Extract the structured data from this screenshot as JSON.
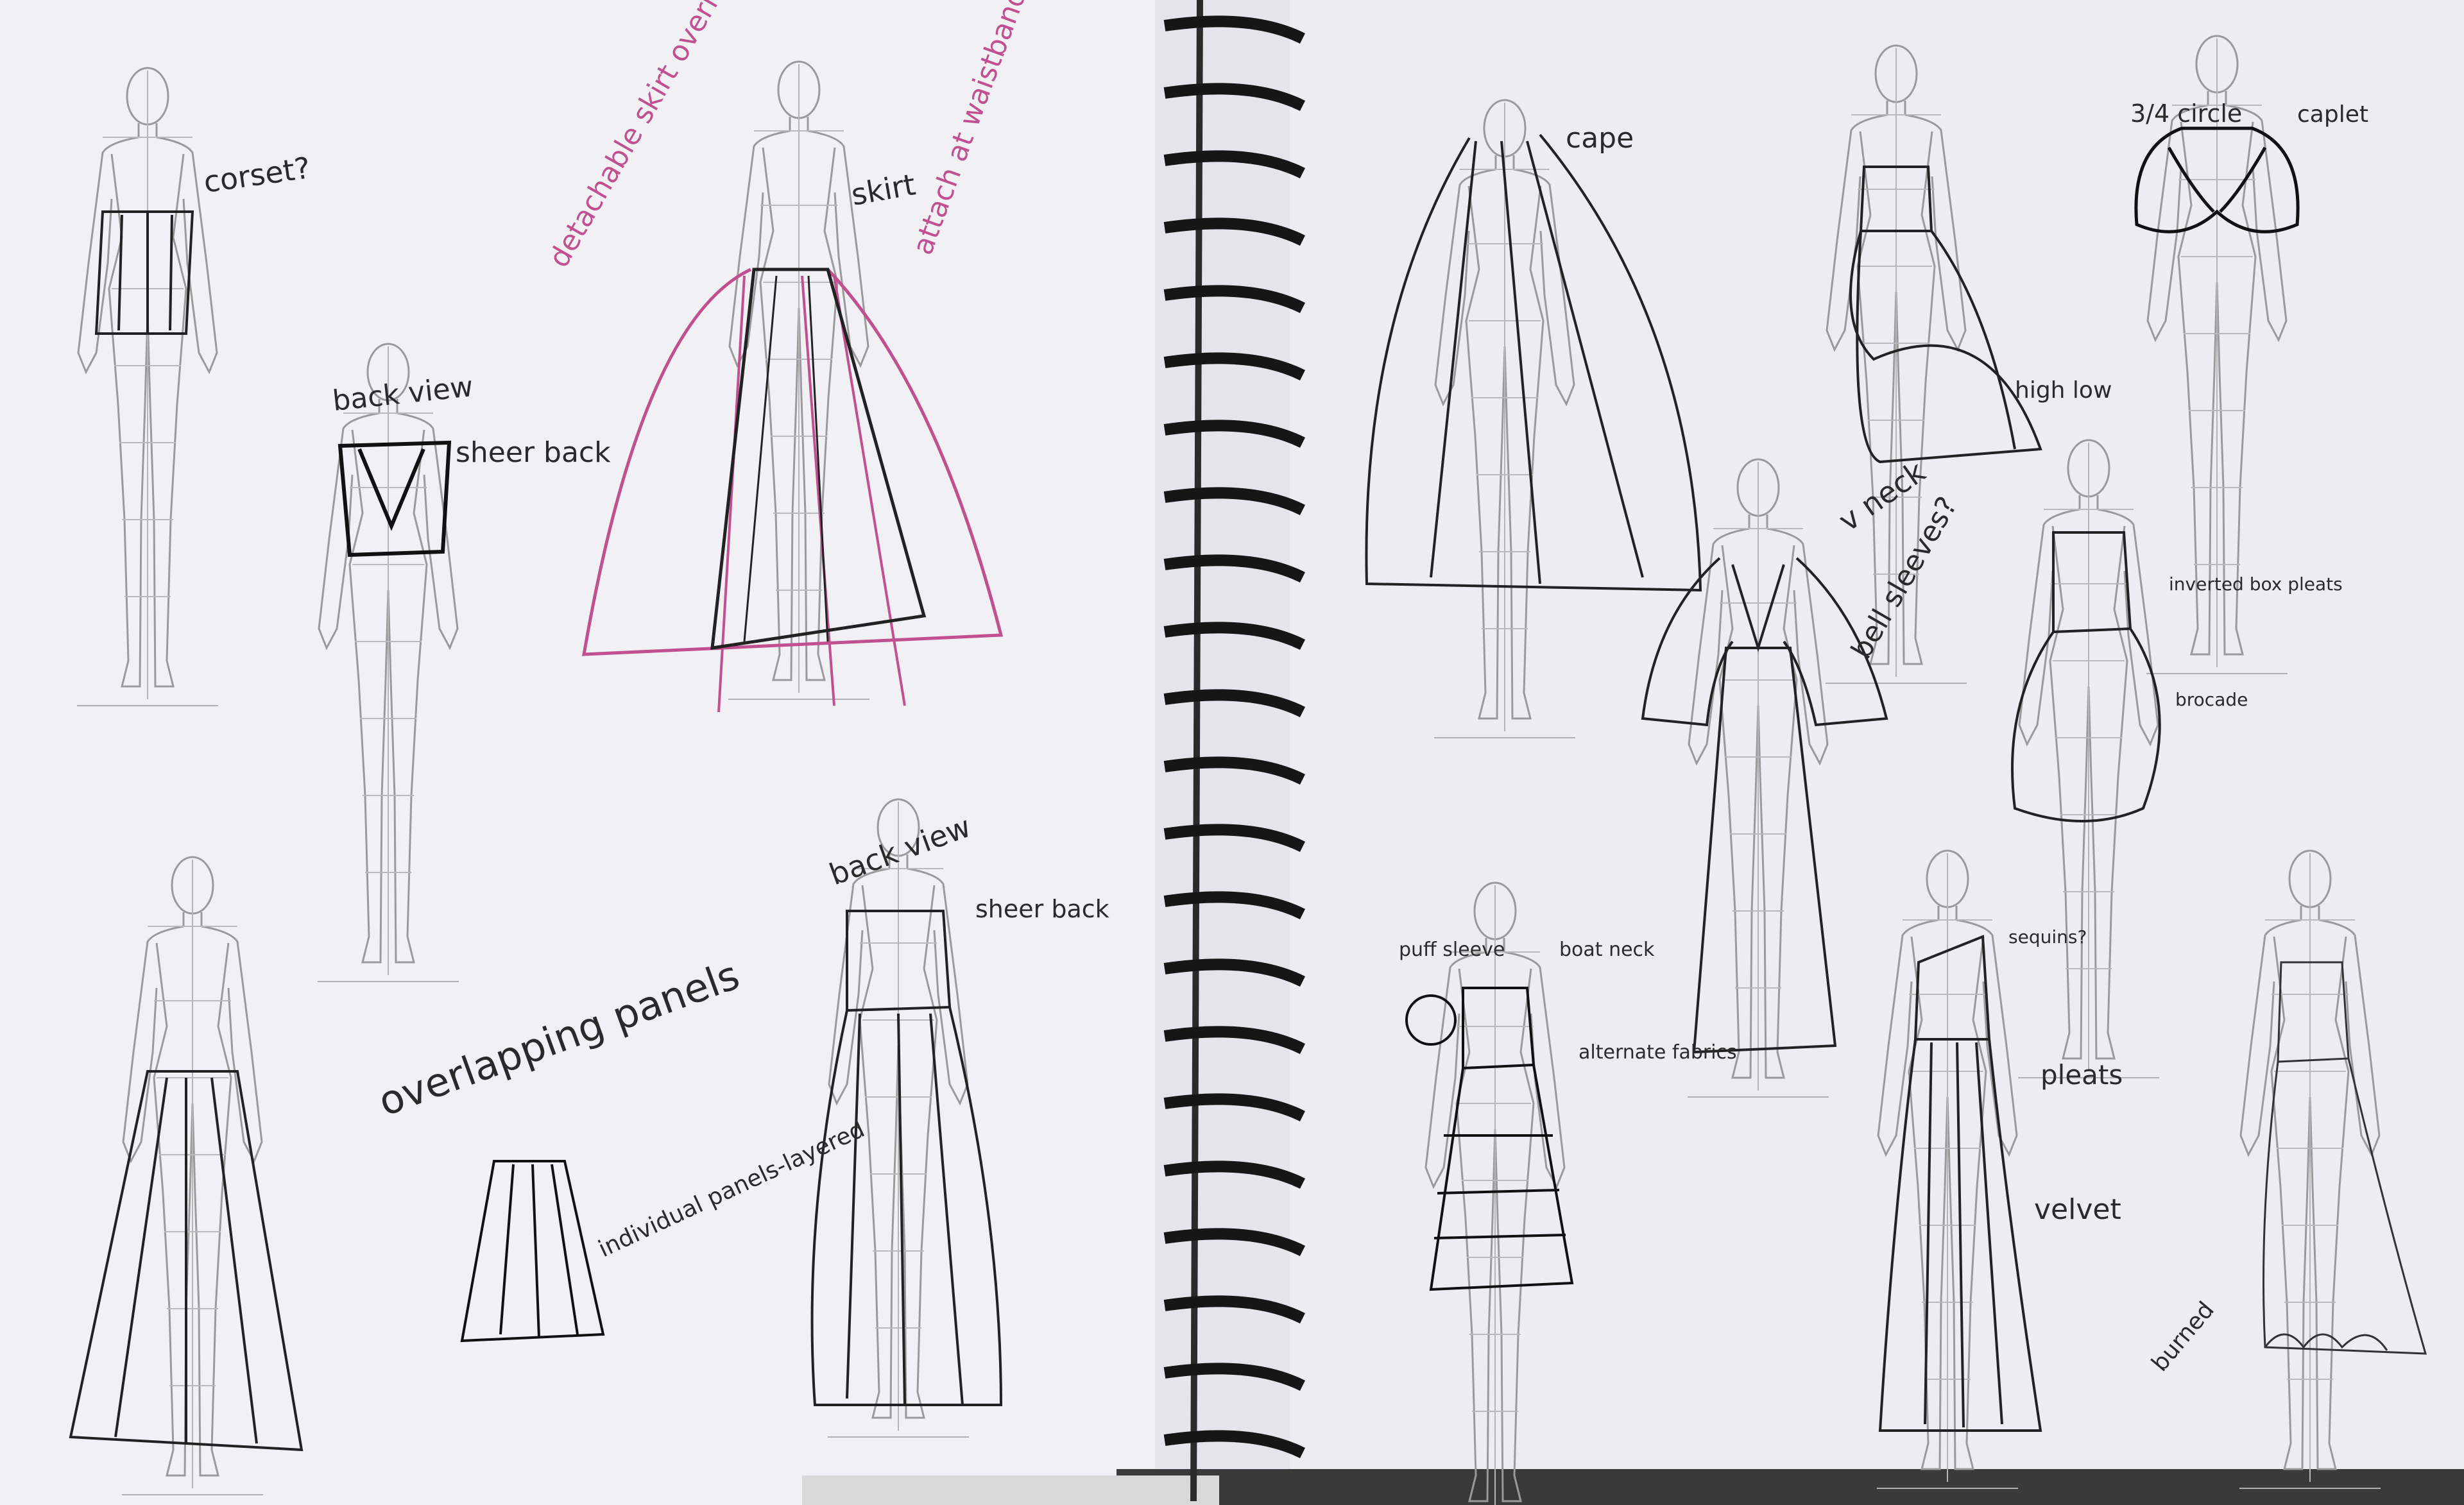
{
  "sketchbook": {
    "left_page": {
      "notes": {
        "corset": "corset?",
        "back_view_1": "back view",
        "sheer_back_1": "sheer back",
        "detachable": "detachable skirt overlay",
        "skirt": "skirt",
        "attach": "attach at waistband",
        "overlapping": "overlapping panels",
        "individual": "individual panels-layered",
        "back_view_2": "back view",
        "sheer_back_2": "sheer back"
      }
    },
    "right_page": {
      "notes": {
        "cape": "cape",
        "circle": "3/4 circle",
        "caplet": "caplet",
        "high_low": "high low",
        "v_neck": "v neck",
        "bell_sleeves": "bell sleeves?",
        "inverted": "inverted box pleats",
        "brocade": "brocade",
        "puff_sleeve": "puff sleeve",
        "boat_neck": "boat neck",
        "alternate": "alternate fabrics",
        "sequins": "sequins?",
        "pleats": "pleats",
        "velvet": "velvet",
        "burned": "burned"
      }
    },
    "colors": {
      "paper": "#f3f3f6",
      "pencil": "#8c8c8c",
      "ink": "#1f1f1f",
      "pink_ink": "#c0508f",
      "binding": "#1a1a1a"
    }
  }
}
